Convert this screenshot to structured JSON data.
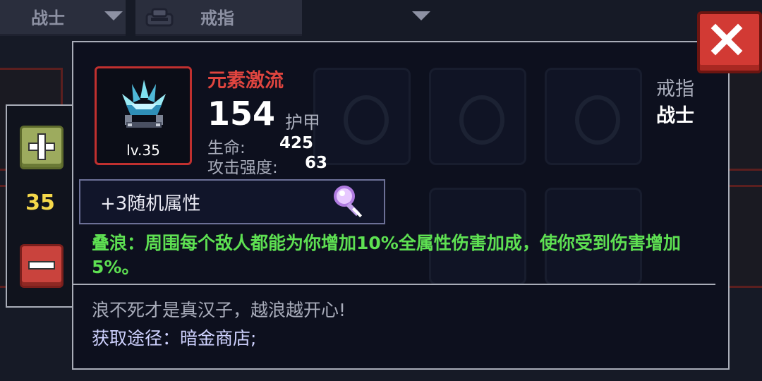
{
  "top_bar": {
    "class_filter": "战士",
    "slot_filter": "戒指"
  },
  "level_adjust": {
    "value": "35"
  },
  "item": {
    "name": "元素激流",
    "level_label": "lv.35",
    "armor_value": "154",
    "armor_label": "护甲",
    "stats": [
      {
        "label": "生命:",
        "value": "425"
      },
      {
        "label": "攻击强度:",
        "value": "63"
      }
    ],
    "slot": "戒指",
    "class": "战士",
    "random_attributes": "+3随机属性",
    "effect": "叠浪：周围每个敌人都能为你增加10%全属性伤害加成，使你受到伤害增加5%。",
    "flavor": "浪不死才是真汉子，越浪越开心!",
    "source": "获取途径：暗金商店;"
  },
  "colors": {
    "item_name": "#e0453f",
    "effect_text": "#5ee052",
    "level_value": "#f5d84a",
    "close_button": "#d23a34"
  },
  "icons": [
    "slot-ring-icon",
    "ice-crystal-ring-icon",
    "magnifier-icon",
    "close-icon",
    "plus-icon",
    "minus-icon"
  ]
}
